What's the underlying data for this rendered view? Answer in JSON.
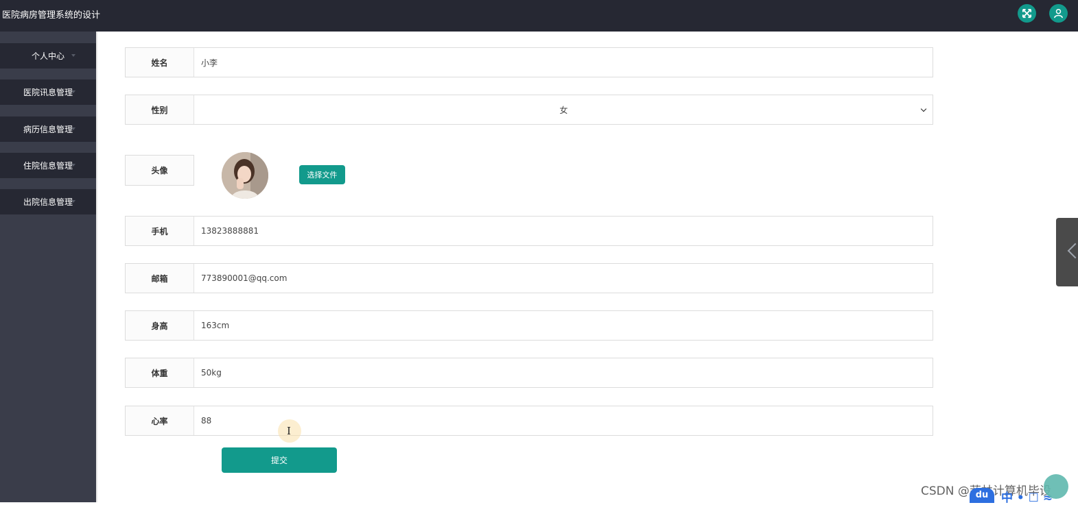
{
  "header": {
    "app_title": "医院病房管理系统的设计",
    "icons": [
      "expand-icon",
      "user-icon"
    ],
    "accent_color": "#129a8c",
    "bar_color": "#262833"
  },
  "sidebar": {
    "items": [
      {
        "label": "个人中心"
      },
      {
        "label": "医院讯息管理"
      },
      {
        "label": "病历信息管理"
      },
      {
        "label": "住院信息管理"
      },
      {
        "label": "出院信息管理"
      }
    ]
  },
  "form": {
    "name": {
      "label": "姓名",
      "value": "小李"
    },
    "gender": {
      "label": "性别",
      "value": "女"
    },
    "avatar": {
      "label": "头像",
      "button": "选择文件"
    },
    "phone": {
      "label": "手机",
      "value": "13823888881"
    },
    "email": {
      "label": "邮箱",
      "value": "773890001@qq.com"
    },
    "height": {
      "label": "身高",
      "value": "163cm"
    },
    "weight": {
      "label": "体重",
      "value": "50kg"
    },
    "heart_rate": {
      "label": "心率",
      "value": "88"
    },
    "submit_label": "提交"
  },
  "overlay": {
    "watermark": "CSDN @菲林计算机毕设",
    "ime_logo": "du",
    "ime_text": "中 • ☐ ≈"
  }
}
